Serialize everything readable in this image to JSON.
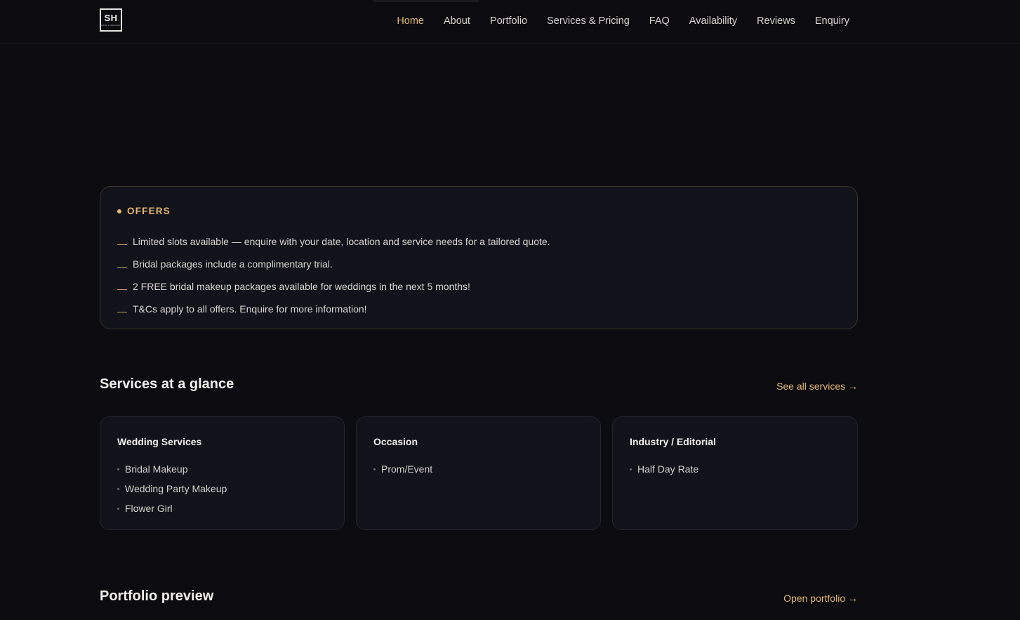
{
  "logo": {
    "monogram": "SH",
    "tagline": "HAIR & MAKEUP"
  },
  "nav": {
    "items": [
      "Home",
      "About",
      "Portfolio",
      "Services & Pricing",
      "FAQ",
      "Availability",
      "Reviews",
      "Enquiry"
    ],
    "active": "Home"
  },
  "offers": {
    "title": "OFFERS",
    "items": [
      "Limited slots available — enquire with your date, location and service needs for a tailored quote.",
      "Bridal packages include a complimentary trial.",
      "2 FREE bridal makeup packages available for weddings in the next 5 months!",
      "T&Cs apply to all offers. Enquire for more information!"
    ]
  },
  "services": {
    "title": "Services at a glance",
    "link": "See all services →",
    "cards": [
      {
        "title": "Wedding Services",
        "items": [
          "Bridal Makeup",
          "Wedding Party Makeup",
          "Flower Girl"
        ]
      },
      {
        "title": "Occasion",
        "items": [
          "Prom/Event"
        ]
      },
      {
        "title": "Industry / Editorial",
        "items": [
          "Half Day Rate"
        ]
      }
    ]
  },
  "portfolio": {
    "title": "Portfolio preview",
    "link": "Open portfolio →"
  },
  "colors": {
    "accent": "#e3b872",
    "background": "#0b0b10",
    "card": "#11121a"
  }
}
